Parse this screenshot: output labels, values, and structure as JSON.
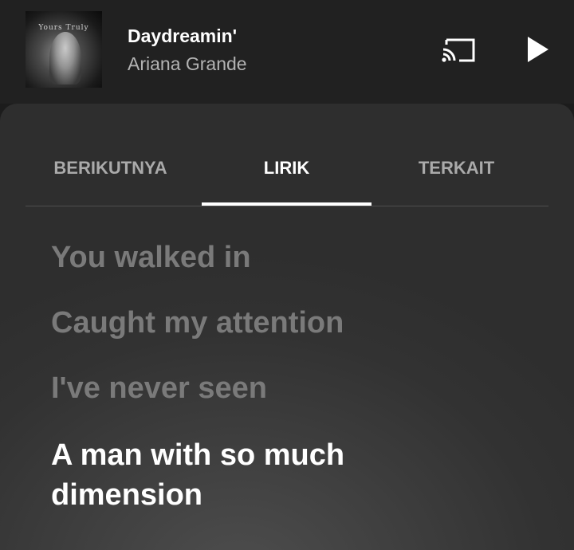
{
  "player": {
    "title": "Daydreamin'",
    "artist": "Ariana Grande",
    "album_art_text": "Yours Truly"
  },
  "tabs": [
    {
      "label": "BERIKUTNYA",
      "active": false
    },
    {
      "label": "LIRIK",
      "active": true
    },
    {
      "label": "TERKAIT",
      "active": false
    }
  ],
  "lyrics": [
    {
      "text": "You walked in",
      "current": false
    },
    {
      "text": "Caught my attention",
      "current": false
    },
    {
      "text": "I've never seen",
      "current": false
    },
    {
      "text": "A man with so much dimension",
      "current": true
    }
  ],
  "icons": {
    "cast": "cast-icon",
    "play": "play-icon"
  },
  "colors": {
    "background": "#1c1c1c",
    "text_primary": "#ffffff",
    "text_secondary": "#b3b3b3",
    "lyric_inactive": "#7a7a7a"
  }
}
